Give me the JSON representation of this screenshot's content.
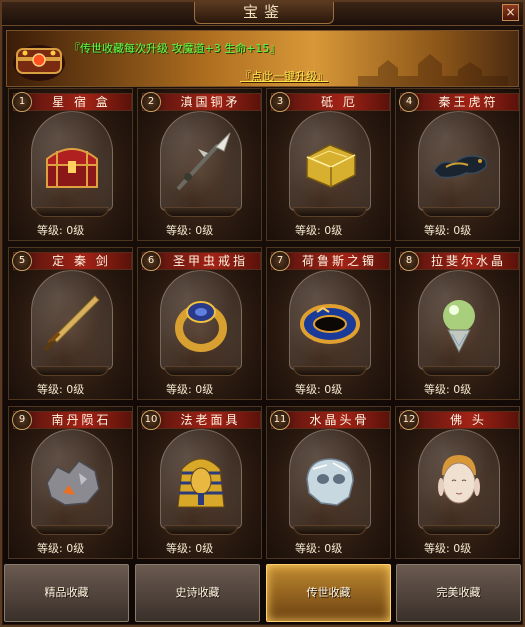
{
  "window": {
    "title": "宝鉴",
    "close_glyph": "×"
  },
  "banner": {
    "bonus_text": "『传世收藏每次升级 攻魔道+3 生命+15』",
    "upgrade_link": "『点此一键升级』"
  },
  "items": [
    {
      "num": "1",
      "name": "星 宿 盒",
      "level": "等级: 0级",
      "icon": "treasure-chest-icon"
    },
    {
      "num": "2",
      "name": "滇国铜矛",
      "level": "等级: 0级",
      "icon": "bronze-spear-icon"
    },
    {
      "num": "3",
      "name": "砥  厄",
      "level": "等级: 0级",
      "icon": "gold-block-icon"
    },
    {
      "num": "4",
      "name": "秦王虎符",
      "level": "等级: 0级",
      "icon": "tiger-tally-icon"
    },
    {
      "num": "5",
      "name": "定 秦 剑",
      "level": "等级: 0级",
      "icon": "sword-icon"
    },
    {
      "num": "6",
      "name": "圣甲虫戒指",
      "level": "等级: 0级",
      "icon": "scarab-ring-icon"
    },
    {
      "num": "7",
      "name": "荷鲁斯之镯",
      "level": "等级: 0级",
      "icon": "horus-bracelet-icon"
    },
    {
      "num": "8",
      "name": "拉斐尔水晶",
      "level": "等级: 0级",
      "icon": "crystal-orb-icon"
    },
    {
      "num": "9",
      "name": "南丹陨石",
      "level": "等级: 0级",
      "icon": "meteorite-icon"
    },
    {
      "num": "10",
      "name": "法老面具",
      "level": "等级: 0级",
      "icon": "pharaoh-mask-icon"
    },
    {
      "num": "11",
      "name": "水晶头骨",
      "level": "等级: 0级",
      "icon": "crystal-skull-icon"
    },
    {
      "num": "12",
      "name": "佛  头",
      "level": "等级: 0级",
      "icon": "buddha-head-icon"
    }
  ],
  "tabs": [
    {
      "label": "精品收藏",
      "active": false
    },
    {
      "label": "史诗收藏",
      "active": false
    },
    {
      "label": "传世收藏",
      "active": true
    },
    {
      "label": "完美收藏",
      "active": false
    }
  ],
  "colors": {
    "banner_text": "#5cff48",
    "link_text": "#ffe64a",
    "header_red": "#a22216",
    "active_tab": "#c08a30"
  }
}
